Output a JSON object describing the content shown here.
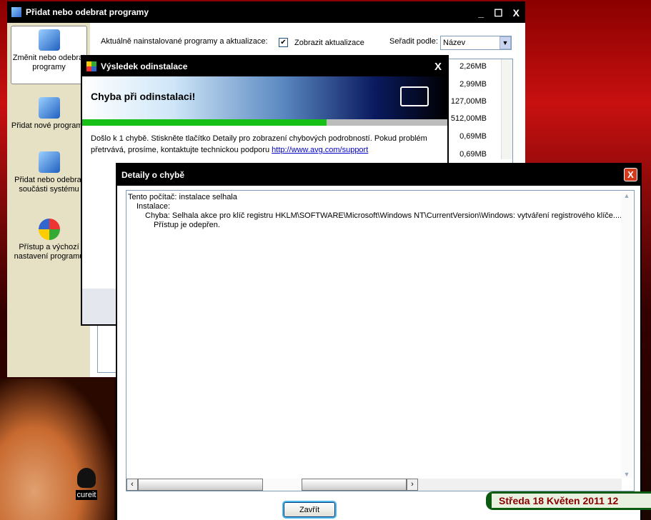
{
  "main_window": {
    "title": "Přidat nebo odebrat programy",
    "minimize": "_",
    "maximize": "☐",
    "close": "X",
    "sidebar": [
      {
        "label": "Změnit nebo odebrat programy"
      },
      {
        "label": "Přidat nové programy"
      },
      {
        "label": "Přidat nebo odebrat součásti systému"
      },
      {
        "label": "Přístup a výchozí nastavení programů"
      }
    ],
    "installed_label": "Aktuálně nainstalované programy a aktualizace:",
    "show_updates": {
      "label": "Zobrazit aktualizace",
      "checked": true
    },
    "sort_label": "Seřadit podle:",
    "sort_value": "Název",
    "sizes": [
      "2,26MB",
      "2,99MB",
      "127,00MB",
      "512,00MB",
      "0,69MB",
      "0,69MB"
    ]
  },
  "result_dialog": {
    "title": "Výsledek odinstalace",
    "close": "X",
    "heading": "Chyba při odinstalaci!",
    "progress": 0.67,
    "message": "Došlo k 1 chybě. Stiskněte tlačítko Detaily pro zobrazení chybových podrobností. Pokud problém přetrvává, prosíme, kontaktujte technickou podporu",
    "link": "http://www.avg.com/support"
  },
  "details_dialog": {
    "title": "Detaily o chybě",
    "close": "X",
    "lines": [
      "Tento počítač: instalace selhala",
      "Instalace:",
      "Chyba: Selhala akce pro klíč registru HKLM\\SOFTWARE\\Microsoft\\Windows NT\\CurrentVersion\\Windows: vytváření registrového klíče....",
      "Přístup je odepřen."
    ],
    "close_button": "Zavřít"
  },
  "desktop": {
    "icon_label": "cureit",
    "clock": "Středa 18 Květen 2011  12"
  }
}
